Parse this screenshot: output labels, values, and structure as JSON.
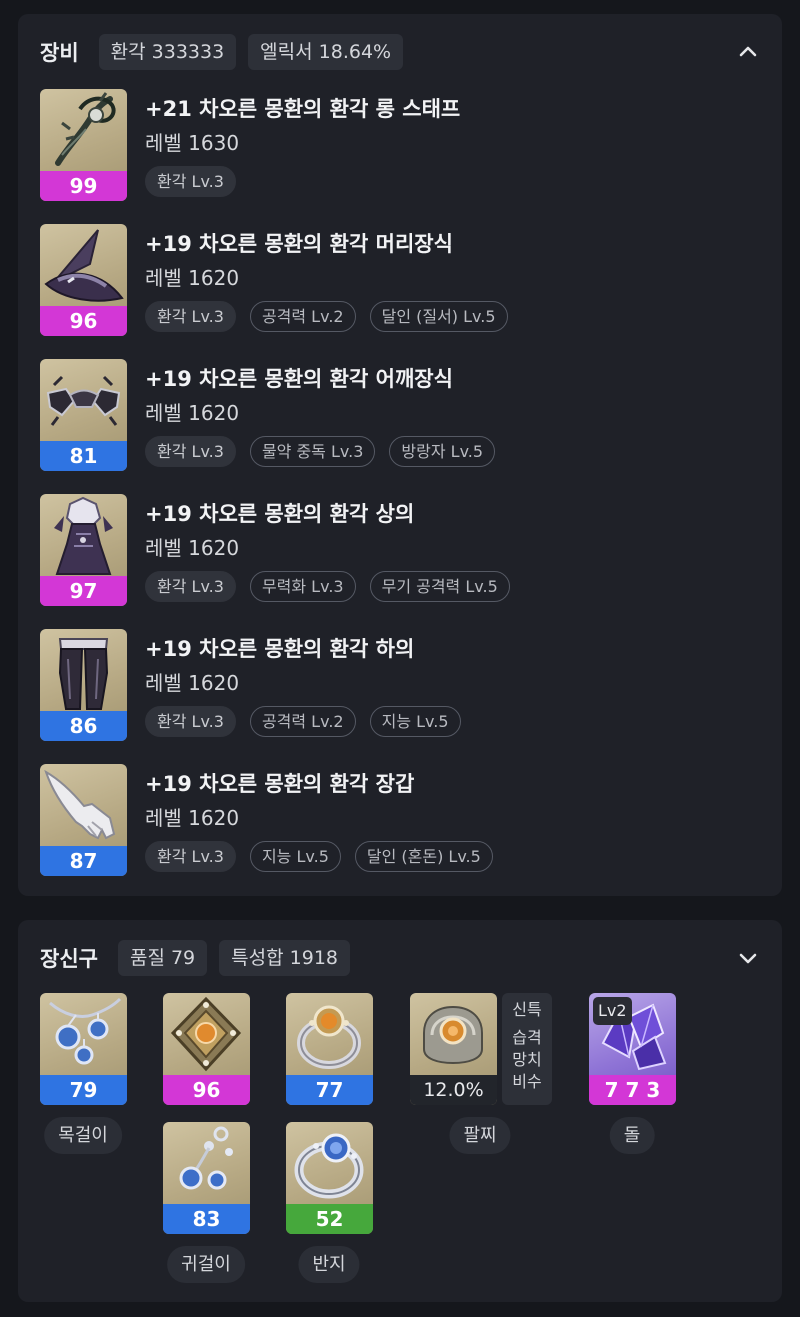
{
  "equipment": {
    "title": "장비",
    "badges": [
      "환각 333333",
      "엘릭서 18.64%"
    ],
    "items": [
      {
        "name": "+21 차오른 몽환의 환각 롱 스태프",
        "level": "레벨 1630",
        "quality": "99",
        "quality_color": "#d337d6",
        "icon": "staff-icon",
        "tags": [
          {
            "text": "환각 Lv.3",
            "style": "solid"
          }
        ]
      },
      {
        "name": "+19 차오른 몽환의 환각 머리장식",
        "level": "레벨 1620",
        "quality": "96",
        "quality_color": "#d337d6",
        "icon": "witch-hat-icon",
        "tags": [
          {
            "text": "환각 Lv.3",
            "style": "solid"
          },
          {
            "text": "공격력 Lv.2",
            "style": "outline"
          },
          {
            "text": "달인 (질서) Lv.5",
            "style": "outline"
          }
        ]
      },
      {
        "name": "+19 차오른 몽환의 환각 어깨장식",
        "level": "레벨 1620",
        "quality": "81",
        "quality_color": "#2f74e2",
        "icon": "shoulder-icon",
        "tags": [
          {
            "text": "환각 Lv.3",
            "style": "solid"
          },
          {
            "text": "물약 중독 Lv.3",
            "style": "outline"
          },
          {
            "text": "방랑자 Lv.5",
            "style": "outline"
          }
        ]
      },
      {
        "name": "+19 차오른 몽환의 환각 상의",
        "level": "레벨 1620",
        "quality": "97",
        "quality_color": "#d337d6",
        "icon": "dress-icon",
        "tags": [
          {
            "text": "환각 Lv.3",
            "style": "solid"
          },
          {
            "text": "무력화 Lv.3",
            "style": "outline"
          },
          {
            "text": "무기 공격력 Lv.5",
            "style": "outline"
          }
        ]
      },
      {
        "name": "+19 차오른 몽환의 환각 하의",
        "level": "레벨 1620",
        "quality": "86",
        "quality_color": "#2f74e2",
        "icon": "pants-icon",
        "tags": [
          {
            "text": "환각 Lv.3",
            "style": "solid"
          },
          {
            "text": "공격력 Lv.2",
            "style": "outline"
          },
          {
            "text": "지능 Lv.5",
            "style": "outline"
          }
        ]
      },
      {
        "name": "+19 차오른 몽환의 환각 장갑",
        "level": "레벨 1620",
        "quality": "87",
        "quality_color": "#2f74e2",
        "icon": "glove-icon",
        "tags": [
          {
            "text": "환각 Lv.3",
            "style": "solid"
          },
          {
            "text": "지능 Lv.5",
            "style": "outline"
          },
          {
            "text": "달인 (혼돈) Lv.5",
            "style": "outline"
          }
        ]
      }
    ]
  },
  "accessories": {
    "title": "장신구",
    "badges": [
      "품질 79",
      "특성합 1918"
    ],
    "necklace": {
      "quality": "79",
      "label": "목걸이",
      "icon": "necklace-icon"
    },
    "earring1": {
      "quality": "96",
      "icon": "earring-gold-icon"
    },
    "earring2": {
      "quality": "83",
      "icon": "earring-blue-icon"
    },
    "earring_label": "귀걸이",
    "ring1": {
      "quality": "77",
      "icon": "ring-gold-icon"
    },
    "ring2": {
      "quality": "52",
      "icon": "ring-blue-icon"
    },
    "ring_label": "반지",
    "bracelet": {
      "percent": "12.0%",
      "label": "팔찌",
      "icon": "bracelet-icon",
      "effects": {
        "main": "신특",
        "list": [
          "습격",
          "망치",
          "비수"
        ]
      }
    },
    "stone": {
      "level_badge": "Lv2",
      "value": "7 7 3",
      "label": "돌",
      "icon": "stone-icon"
    }
  },
  "colors": {
    "purple": "#d337d6",
    "blue": "#2f74e2",
    "green": "#46a83c"
  }
}
